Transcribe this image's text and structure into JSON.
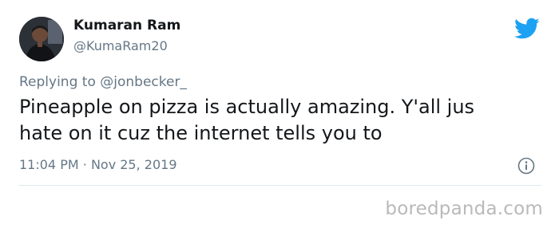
{
  "tweet": {
    "display_name": "Kumaran Ram",
    "handle": "@KumaRam20",
    "replying_prefix": "Replying to",
    "replying_to": "@jonbecker_",
    "text_line1": "Pineapple on pizza is actually amazing. Y'all jus",
    "text_line2": "hate on it cuz the internet tells you to",
    "time": "11:04 PM",
    "separator": "·",
    "date": "Nov 25, 2019"
  },
  "icons": {
    "brand": "twitter-bird-icon",
    "info": "info-icon"
  },
  "colors": {
    "brand_blue": "#1da1f2",
    "secondary_text": "#657786",
    "primary_text": "#14171a",
    "divider": "#e1e8ed",
    "watermark": "#b9b9b9"
  },
  "watermark": "boredpanda.com"
}
